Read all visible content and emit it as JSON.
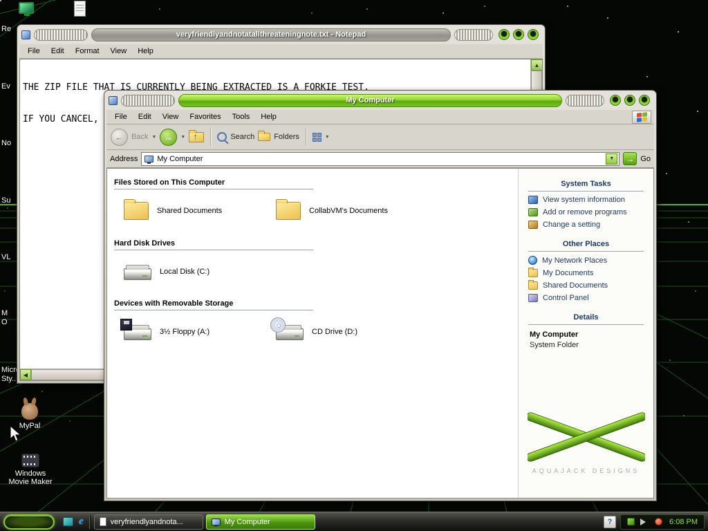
{
  "glyphs": {
    "back": "←",
    "forward": "→",
    "up": "↑",
    "dropdown": "▼",
    "go": "→",
    "scroll_up": "▲",
    "scroll_down": "▼",
    "scroll_left": "◀",
    "scroll_right": "▶",
    "help": "?",
    "ie_logo": "e"
  },
  "desktop": {
    "edge_labels": [
      "Re",
      "Ev",
      "No",
      "Su",
      "VL",
      "M",
      "O",
      "Micro Sty..."
    ],
    "icons": [
      {
        "label": "MyPal"
      },
      {
        "label": "Windows Movie Maker"
      }
    ]
  },
  "notepad": {
    "title": "veryfriendlyandnotatallthreateningnote.txt - Notepad",
    "menus": [
      "File",
      "Edit",
      "Format",
      "View",
      "Help"
    ],
    "lines": [
      "THE ZIP FILE THAT IS CURRENTLY BEING EXTRACTED IS A FORKIE TEST.",
      "IF YOU CANCEL, PAUSE, OR DELETE IT, YOU WILL FAIL AND BE MARKED AS A FORKIE."
    ]
  },
  "explorer": {
    "title": "My Computer",
    "menus": [
      "File",
      "Edit",
      "View",
      "Favorites",
      "Tools",
      "Help"
    ],
    "toolbar": {
      "back": "Back",
      "search": "Search",
      "folders": "Folders"
    },
    "address": {
      "label": "Address",
      "value": "My Computer",
      "go": "Go"
    },
    "sections": [
      {
        "title": "Files Stored on This Computer",
        "items": [
          {
            "label": "Shared Documents"
          },
          {
            "label": "CollabVM's Documents"
          }
        ]
      },
      {
        "title": "Hard Disk Drives",
        "items": [
          {
            "label": "Local Disk (C:)"
          }
        ]
      },
      {
        "title": "Devices with Removable Storage",
        "items": [
          {
            "label": "3½ Floppy (A:)"
          },
          {
            "label": "CD Drive (D:)"
          }
        ]
      }
    ],
    "sidebar": {
      "system_tasks": {
        "title": "System Tasks",
        "items": [
          "View system information",
          "Add or remove programs",
          "Change a setting"
        ]
      },
      "other_places": {
        "title": "Other Places",
        "items": [
          "My Network Places",
          "My Documents",
          "Shared Documents",
          "Control Panel"
        ]
      },
      "details": {
        "title": "Details",
        "name": "My Computer",
        "type": "System Folder"
      },
      "watermark": "AQUAJACK DESIGNS"
    }
  },
  "taskbar": {
    "tasks": [
      {
        "label": "veryfriendlyandnota..."
      },
      {
        "label": "My Computer"
      }
    ],
    "clock": "6:08 PM"
  }
}
